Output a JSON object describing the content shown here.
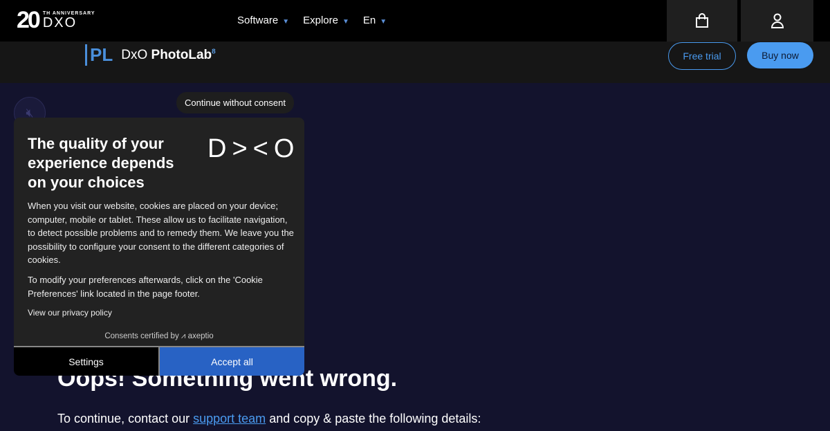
{
  "header": {
    "logo_number": "20",
    "logo_anniversary": "TH ANNIVERSARY",
    "logo_of": "OF",
    "logo_brand": "DXO",
    "nav": [
      {
        "label": "Software"
      },
      {
        "label": "Explore"
      },
      {
        "label": "En"
      }
    ],
    "icons": [
      "shopping-bag-icon",
      "user-icon"
    ]
  },
  "product_bar": {
    "badge": "PL",
    "brand": "DxO",
    "product": "PhotoLab",
    "version": "8",
    "free_trial": "Free trial",
    "buy_now": "Buy now"
  },
  "consent": {
    "continue_without": "Continue without consent",
    "title": "The quality of your experience depends on your choices",
    "logo": "DXO",
    "body1": "When you visit our website, cookies are placed on your device; computer, mobile or tablet. These allow us to facilitate navigation, to detect possible problems and to remedy them. We leave you the possibility to configure your consent to the different categories of cookies.",
    "body2": "To modify your preferences afterwards, click on the 'Cookie Preferences' link located in the page footer.",
    "privacy": "View our privacy policy",
    "certified": "Consents certified by ⩘ axeptio",
    "settings": "Settings",
    "accept": "Accept all"
  },
  "error": {
    "title": "Oops! Something went wrong.",
    "pre": "To continue, contact our ",
    "link": "support team",
    "post": " and copy & paste the following details:"
  },
  "colors": {
    "accent": "#4a9bf0",
    "accept": "#2862c4",
    "page_bg": "#13132d"
  }
}
